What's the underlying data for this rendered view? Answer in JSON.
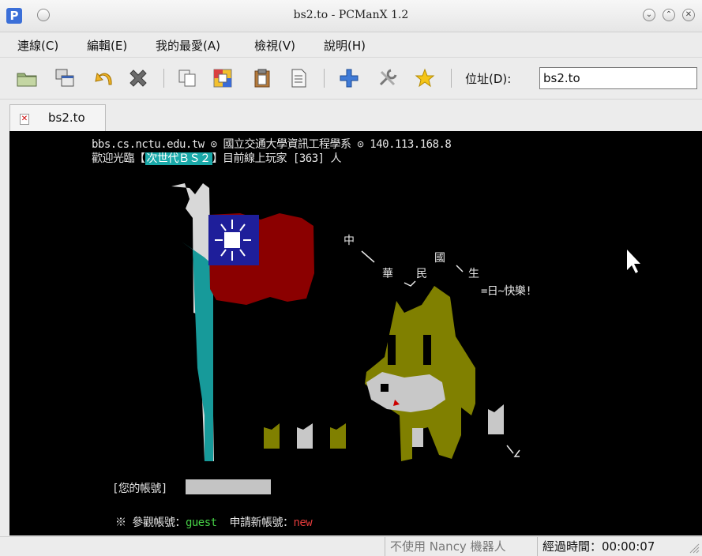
{
  "window": {
    "app_icon": "P",
    "title": "bs2.to - PCManX 1.2",
    "controls": [
      "minimize-icon",
      "maximize-icon",
      "close-icon"
    ]
  },
  "menu": [
    "連線(C)",
    "編輯(E)",
    "我的最愛(A)",
    "檢視(V)",
    "說明(H)"
  ],
  "toolbar": {
    "icons": [
      "open-folder-icon",
      "new-window-icon",
      "reconnect-icon",
      "disconnect-icon",
      "copy-icon",
      "color-copy-icon",
      "paste-icon",
      "select-all-icon",
      "add-bookmark-icon",
      "settings-icon",
      "favorites-star-icon"
    ],
    "address_label": "位址(D):",
    "address_value": "bs2.to"
  },
  "tabs": [
    {
      "label": "bs2.to"
    }
  ],
  "terminal": {
    "line1": "bbs.cs.nctu.edu.tw ⊙ 國立交通大學資訊工程學系 ⊙ 140.113.168.8",
    "line2_before": "歡迎光臨【",
    "line2_highlight": "次世代ＢＳ２",
    "line2_after": "】目前線上玩家 [363] 人",
    "art_zhong": "中",
    "art_guo": "國",
    "art_hua": "華",
    "art_min": "民",
    "art_sheng": "生",
    "art_kuaile": "=日~快樂!",
    "login_prompt": "[您的帳號]",
    "guest_prefix": "※ 參觀帳號：",
    "guest_value": "guest",
    "new_prefix": "申請新帳號：",
    "new_value": "new"
  },
  "status": {
    "nancy": "不使用 Nancy 機器人",
    "elapsed": "經過時間：00:00:07"
  },
  "colors": {
    "terminal_bg": "#000000",
    "highlight": "#1aa9a9",
    "flag_red": "#8b0000",
    "flag_blue": "#1e1e9a",
    "dog": "#808000",
    "guest": "#46d146",
    "new": "#e23b3b"
  }
}
